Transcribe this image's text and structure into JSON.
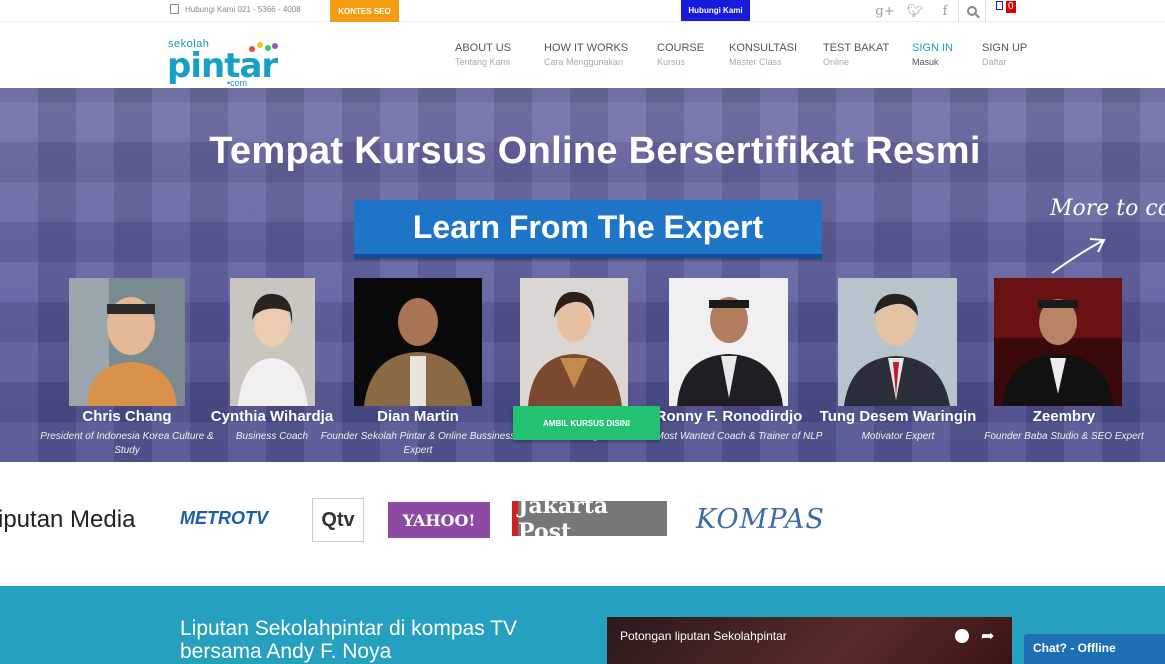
{
  "topbar": {
    "phone": "Hubungi Kami 021 - 5366 - 4008",
    "kontes": "KONTES SEO",
    "hubungi": "Hubungi Kami",
    "social": [
      "g+",
      "twitter",
      "facebook"
    ],
    "cart_count": "0"
  },
  "logo": {
    "small": "sekolah",
    "big": "pintar",
    "com": "•com"
  },
  "nav": [
    {
      "title": "ABOUT US",
      "sub": "Tentang Kami"
    },
    {
      "title": "HOW IT WORKS",
      "sub": "Cara Menggunakan"
    },
    {
      "title": "COURSE",
      "sub": "Kursus"
    },
    {
      "title": "KONSULTASI",
      "sub": "Master Class"
    },
    {
      "title": "TEST BAKAT",
      "sub": "Online"
    },
    {
      "title": "SIGN IN",
      "sub": "Masuk"
    },
    {
      "title": "SIGN UP",
      "sub": "Daftar"
    }
  ],
  "hero": {
    "title": "Tempat Kursus Online Bersertifikat Resmi",
    "banner": "Learn From The Expert",
    "more": "More to co",
    "cta": "AMBIL KURSUS DISINI",
    "experts": [
      {
        "name": "Chris Chang",
        "role": "President of Indonesia Korea Culture & Study"
      },
      {
        "name": "Cynthia Wihardja",
        "role": "Business Coach"
      },
      {
        "name": "Dian Martin",
        "role": "Founder Sekolah Pintar & Online Bussiness Expert"
      },
      {
        "name": "",
        "role": "Fashion Designer"
      },
      {
        "name": "Ronny F. Ronodirdjo",
        "role": "The Most Wanted Coach & Trainer of NLP"
      },
      {
        "name": "Tung Desem Waringin",
        "role": "Motivator Expert"
      },
      {
        "name": "Zeembry",
        "role": "Founder Baba Studio & SEO Expert"
      }
    ]
  },
  "media": {
    "label": "iputan Media",
    "logos": [
      "METROTV",
      "Qtv",
      "YAHOO!",
      "Jakarta Post",
      "KOMPAS"
    ]
  },
  "feature": {
    "headline": "Liputan Sekolahpintar di kompas TV bersama Andy F. Noya",
    "video_title": "Potongan liputan Sekolahpintar"
  },
  "chat": {
    "label": "Chat? - Offline"
  },
  "colors": {
    "teal": "#26a0bf",
    "brand": "#16a0c8",
    "cta": "#23c172",
    "banner": "#1e74c6"
  }
}
